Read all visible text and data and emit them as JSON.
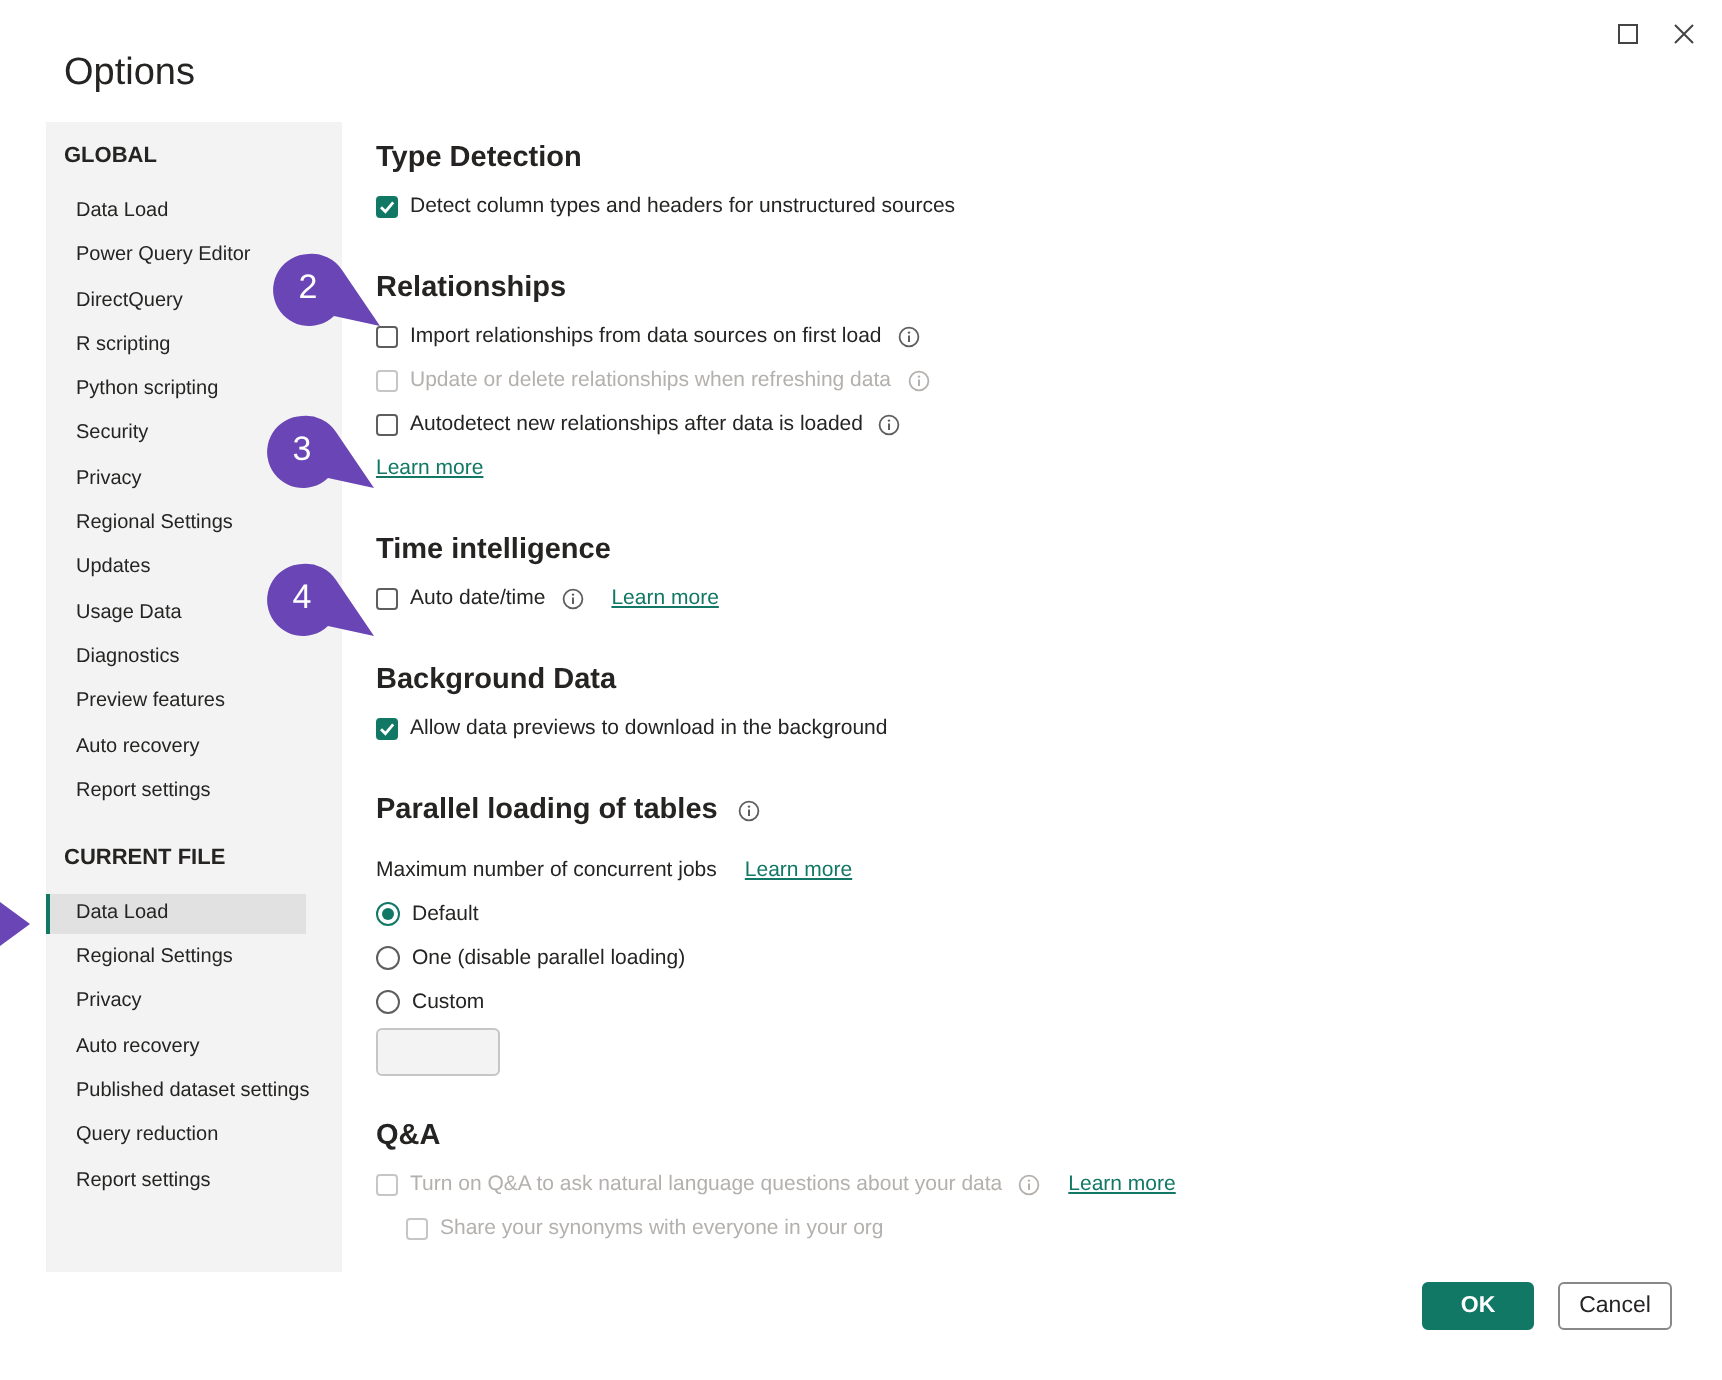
{
  "window": {
    "title": "Options"
  },
  "sidebar": {
    "groups": [
      {
        "heading": "GLOBAL",
        "items": [
          {
            "label": "Data Load",
            "selected": false
          },
          {
            "label": "Power Query Editor",
            "selected": false
          },
          {
            "label": "DirectQuery",
            "selected": false
          },
          {
            "label": "R scripting",
            "selected": false
          },
          {
            "label": "Python scripting",
            "selected": false
          },
          {
            "label": "Security",
            "selected": false
          },
          {
            "label": "Privacy",
            "selected": false
          },
          {
            "label": "Regional Settings",
            "selected": false
          },
          {
            "label": "Updates",
            "selected": false
          },
          {
            "label": "Usage Data",
            "selected": false
          },
          {
            "label": "Diagnostics",
            "selected": false
          },
          {
            "label": "Preview features",
            "selected": false
          },
          {
            "label": "Auto recovery",
            "selected": false
          },
          {
            "label": "Report settings",
            "selected": false
          }
        ]
      },
      {
        "heading": "CURRENT FILE",
        "items": [
          {
            "label": "Data Load",
            "selected": true
          },
          {
            "label": "Regional Settings",
            "selected": false
          },
          {
            "label": "Privacy",
            "selected": false
          },
          {
            "label": "Auto recovery",
            "selected": false
          },
          {
            "label": "Published dataset settings",
            "selected": false
          },
          {
            "label": "Query reduction",
            "selected": false
          },
          {
            "label": "Report settings",
            "selected": false
          }
        ]
      }
    ]
  },
  "sections": [
    {
      "title": "Type Detection",
      "items": [
        {
          "kind": "checkbox",
          "label": "Detect column types and headers for unstructured sources",
          "checked": true,
          "disabled": false
        }
      ]
    },
    {
      "title": "Relationships",
      "items": [
        {
          "kind": "checkbox",
          "label": "Import relationships from data sources on first load",
          "checked": false,
          "disabled": false,
          "info": true
        },
        {
          "kind": "checkbox",
          "label": "Update or delete relationships when refreshing data",
          "checked": false,
          "disabled": true,
          "info": true
        },
        {
          "kind": "checkbox",
          "label": "Autodetect new relationships after data is loaded",
          "checked": false,
          "disabled": false,
          "info": true
        },
        {
          "kind": "link",
          "link": "Learn more"
        }
      ]
    },
    {
      "title": "Time intelligence",
      "items": [
        {
          "kind": "checkbox",
          "label": "Auto date/time",
          "checked": false,
          "disabled": false,
          "info": true,
          "link": "Learn more"
        }
      ]
    },
    {
      "title": "Background Data",
      "items": [
        {
          "kind": "checkbox",
          "label": "Allow data previews to download in the background",
          "checked": true,
          "disabled": false
        }
      ]
    },
    {
      "title": "Parallel loading of tables",
      "info": true,
      "items": [
        {
          "kind": "text",
          "label": "Maximum number of concurrent jobs",
          "link": "Learn more"
        },
        {
          "kind": "radio",
          "label": "Default",
          "selected": true
        },
        {
          "kind": "radio",
          "label": "One (disable parallel loading)",
          "selected": false
        },
        {
          "kind": "radio",
          "label": "Custom",
          "selected": false
        },
        {
          "kind": "input"
        }
      ]
    },
    {
      "title": "Q&A",
      "items": [
        {
          "kind": "checkbox",
          "label": "Turn on Q&A to ask natural language questions about your data",
          "checked": false,
          "disabled": true,
          "info": true,
          "link": "Learn more"
        },
        {
          "kind": "checkbox",
          "label": "Share your synonyms with everyone in your org",
          "checked": false,
          "disabled": true,
          "indented": true
        }
      ]
    }
  ],
  "callouts": [
    {
      "number": "2"
    },
    {
      "number": "3"
    },
    {
      "number": "4"
    }
  ],
  "buttons": [
    {
      "label": "OK",
      "primary": true
    },
    {
      "label": "Cancel",
      "primary": false
    }
  ]
}
